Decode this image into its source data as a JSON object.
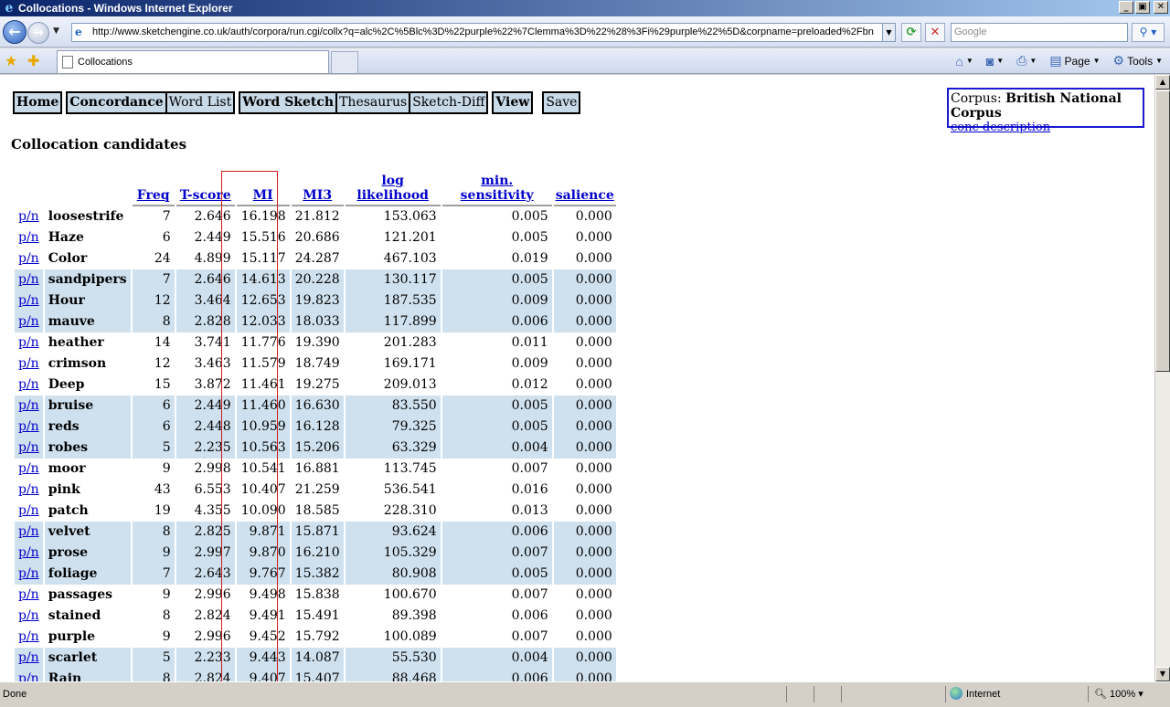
{
  "window": {
    "title": "Collocations - Windows Internet Explorer",
    "min_label": "_",
    "max_label": "▣",
    "close_label": "✕"
  },
  "addressbar": {
    "url": "http://www.sketchengine.co.uk/auth/corpora/run.cgi/collx?q=alc%2C%5Blc%3D%22purple%22%7Clemma%3D%22%28%3Fi%29purple%22%5D&corpname=preloaded%2Fbn",
    "search_placeholder": "Google"
  },
  "tabs": {
    "active_label": "Collocations"
  },
  "commandbar": {
    "page_label": "Page",
    "tools_label": "Tools"
  },
  "nav": {
    "home": "Home",
    "concordance": "Concordance",
    "word_list": "Word List",
    "word_sketch": "Word Sketch",
    "thesaurus": "Thesaurus",
    "sketch_diff": "Sketch-Diff",
    "view": "View",
    "save": "Save"
  },
  "corpus": {
    "label": "Corpus: ",
    "name": "British National Corpus",
    "description_link": "conc description"
  },
  "page_title": "Collocation candidates",
  "table": {
    "headers": {
      "freq": "Freq",
      "tscore": "T-score",
      "mi": "MI",
      "mi3": "MI3",
      "loglik": "log likelihood",
      "minsens": "min. sensitivity",
      "salience": "salience"
    },
    "pn_label": "p/n",
    "rows": [
      {
        "word": "loosestrife",
        "freq": "7",
        "tscore": "2.646",
        "mi": "16.198",
        "mi3": "21.812",
        "loglik": "153.063",
        "minsens": "0.005",
        "salience": "0.000",
        "hl": false
      },
      {
        "word": "Haze",
        "freq": "6",
        "tscore": "2.449",
        "mi": "15.516",
        "mi3": "20.686",
        "loglik": "121.201",
        "minsens": "0.005",
        "salience": "0.000",
        "hl": false
      },
      {
        "word": "Color",
        "freq": "24",
        "tscore": "4.899",
        "mi": "15.117",
        "mi3": "24.287",
        "loglik": "467.103",
        "minsens": "0.019",
        "salience": "0.000",
        "hl": false
      },
      {
        "word": "sandpipers",
        "freq": "7",
        "tscore": "2.646",
        "mi": "14.613",
        "mi3": "20.228",
        "loglik": "130.117",
        "minsens": "0.005",
        "salience": "0.000",
        "hl": true
      },
      {
        "word": "Hour",
        "freq": "12",
        "tscore": "3.464",
        "mi": "12.653",
        "mi3": "19.823",
        "loglik": "187.535",
        "minsens": "0.009",
        "salience": "0.000",
        "hl": true
      },
      {
        "word": "mauve",
        "freq": "8",
        "tscore": "2.828",
        "mi": "12.033",
        "mi3": "18.033",
        "loglik": "117.899",
        "minsens": "0.006",
        "salience": "0.000",
        "hl": true
      },
      {
        "word": "heather",
        "freq": "14",
        "tscore": "3.741",
        "mi": "11.776",
        "mi3": "19.390",
        "loglik": "201.283",
        "minsens": "0.011",
        "salience": "0.000",
        "hl": false
      },
      {
        "word": "crimson",
        "freq": "12",
        "tscore": "3.463",
        "mi": "11.579",
        "mi3": "18.749",
        "loglik": "169.171",
        "minsens": "0.009",
        "salience": "0.000",
        "hl": false
      },
      {
        "word": "Deep",
        "freq": "15",
        "tscore": "3.872",
        "mi": "11.461",
        "mi3": "19.275",
        "loglik": "209.013",
        "minsens": "0.012",
        "salience": "0.000",
        "hl": false
      },
      {
        "word": "bruise",
        "freq": "6",
        "tscore": "2.449",
        "mi": "11.460",
        "mi3": "16.630",
        "loglik": "83.550",
        "minsens": "0.005",
        "salience": "0.000",
        "hl": true
      },
      {
        "word": "reds",
        "freq": "6",
        "tscore": "2.448",
        "mi": "10.959",
        "mi3": "16.128",
        "loglik": "79.325",
        "minsens": "0.005",
        "salience": "0.000",
        "hl": true
      },
      {
        "word": "robes",
        "freq": "5",
        "tscore": "2.235",
        "mi": "10.563",
        "mi3": "15.206",
        "loglik": "63.329",
        "minsens": "0.004",
        "salience": "0.000",
        "hl": true
      },
      {
        "word": "moor",
        "freq": "9",
        "tscore": "2.998",
        "mi": "10.541",
        "mi3": "16.881",
        "loglik": "113.745",
        "minsens": "0.007",
        "salience": "0.000",
        "hl": false
      },
      {
        "word": "pink",
        "freq": "43",
        "tscore": "6.553",
        "mi": "10.407",
        "mi3": "21.259",
        "loglik": "536.541",
        "minsens": "0.016",
        "salience": "0.000",
        "hl": false
      },
      {
        "word": "patch",
        "freq": "19",
        "tscore": "4.355",
        "mi": "10.090",
        "mi3": "18.585",
        "loglik": "228.310",
        "minsens": "0.013",
        "salience": "0.000",
        "hl": false
      },
      {
        "word": "velvet",
        "freq": "8",
        "tscore": "2.825",
        "mi": "9.871",
        "mi3": "15.871",
        "loglik": "93.624",
        "minsens": "0.006",
        "salience": "0.000",
        "hl": true
      },
      {
        "word": "prose",
        "freq": "9",
        "tscore": "2.997",
        "mi": "9.870",
        "mi3": "16.210",
        "loglik": "105.329",
        "minsens": "0.007",
        "salience": "0.000",
        "hl": true
      },
      {
        "word": "foliage",
        "freq": "7",
        "tscore": "2.643",
        "mi": "9.767",
        "mi3": "15.382",
        "loglik": "80.908",
        "minsens": "0.005",
        "salience": "0.000",
        "hl": true
      },
      {
        "word": "passages",
        "freq": "9",
        "tscore": "2.996",
        "mi": "9.498",
        "mi3": "15.838",
        "loglik": "100.670",
        "minsens": "0.007",
        "salience": "0.000",
        "hl": false
      },
      {
        "word": "stained",
        "freq": "8",
        "tscore": "2.824",
        "mi": "9.491",
        "mi3": "15.491",
        "loglik": "89.398",
        "minsens": "0.006",
        "salience": "0.000",
        "hl": false
      },
      {
        "word": "purple",
        "freq": "9",
        "tscore": "2.996",
        "mi": "9.452",
        "mi3": "15.792",
        "loglik": "100.089",
        "minsens": "0.007",
        "salience": "0.000",
        "hl": false
      },
      {
        "word": "scarlet",
        "freq": "5",
        "tscore": "2.233",
        "mi": "9.443",
        "mi3": "14.087",
        "loglik": "55.530",
        "minsens": "0.004",
        "salience": "0.000",
        "hl": true
      },
      {
        "word": "Rain",
        "freq": "8",
        "tscore": "2.824",
        "mi": "9.407",
        "mi3": "15.407",
        "loglik": "88.468",
        "minsens": "0.006",
        "salience": "0.000",
        "hl": true
      }
    ]
  },
  "statusbar": {
    "left": "Done",
    "zone": "Internet",
    "zoom": "100%"
  },
  "colors": {
    "row_highlight": "#cfe1ee",
    "mi_box": "#d41a1a",
    "link": "#0000cc",
    "corpus_border": "#1a1ad0"
  }
}
